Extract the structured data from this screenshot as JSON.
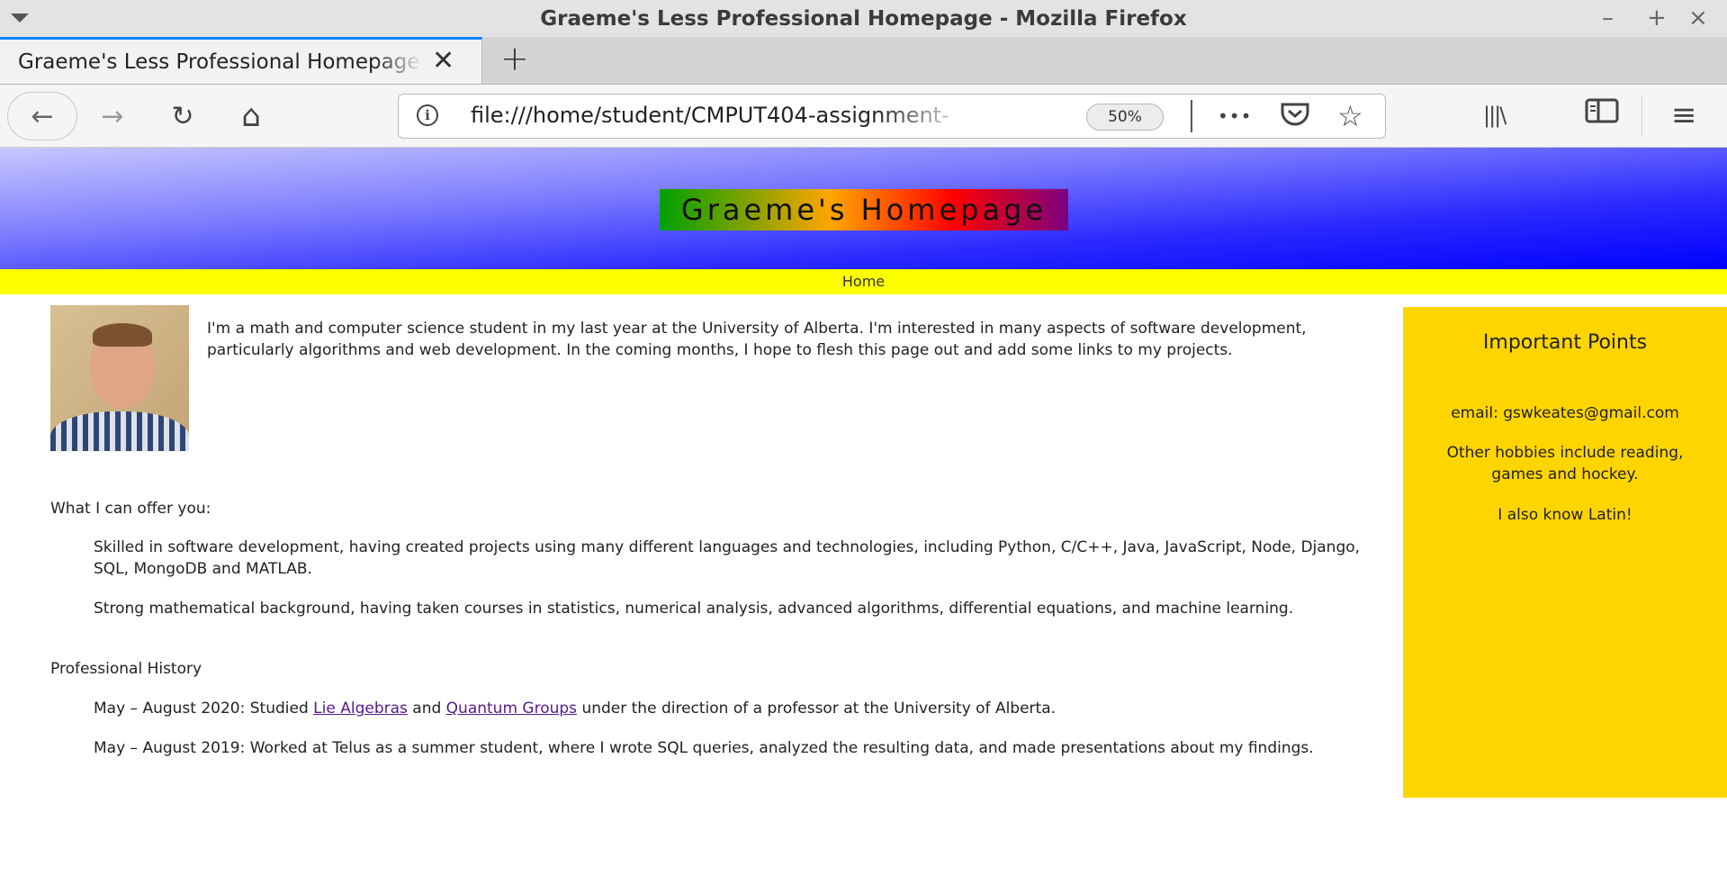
{
  "window": {
    "title": "Graeme's Less Professional Homepage - Mozilla Firefox",
    "minimize": "–",
    "maximize": "+",
    "close": "×"
  },
  "tabs": [
    {
      "label": "Graeme's Less Professional Homepage",
      "close": "✕"
    }
  ],
  "new_tab": "+",
  "toolbar": {
    "url": "file:///home/student/CMPUT404-assignment-",
    "zoom": "50%",
    "back": "←",
    "forward": "→",
    "reload": "↻",
    "home": "⌂",
    "more": "•••",
    "pocket": "◡",
    "bookmark": "☆",
    "library": "|||\\",
    "sidebar": "▯",
    "menu": "≡",
    "info": "i"
  },
  "page": {
    "site_title": "Graeme's Homepage",
    "nav": {
      "home": "Home"
    },
    "intro": "I'm a math and computer science student in my last year at the University of Alberta. I'm interested in many aspects of software development, particularly algorithms and web development. In the coming months, I hope to flesh this page out and add some links to my projects.",
    "offer_heading": "What I can offer you:",
    "offer_1": "Skilled in software development, having created projects using many different languages and technologies, including Python, C/C++, Java, JavaScript, Node, Django, SQL, MongoDB and MATLAB.",
    "offer_2": "Strong mathematical background, having taken courses in statistics, numerical analysis, advanced algorithms, differential equations, and machine learning.",
    "history_heading": "Professional History",
    "history_1": {
      "prefix": "May – August 2020: Studied ",
      "link1": "Lie Algebras",
      "mid": " and ",
      "link2": "Quantum Groups",
      "suffix": " under the direction of a professor at the University of Alberta."
    },
    "history_2": "May – August 2019: Worked at Telus as a summer student, where I wrote SQL queries, analyzed the resulting data, and made presentations about my findings."
  },
  "sidebar": {
    "title": "Important Points",
    "email": "email: gswkeates@gmail.com",
    "hobbies": "Other hobbies include reading, games and hockey.",
    "latin": "I also know Latin!"
  }
}
